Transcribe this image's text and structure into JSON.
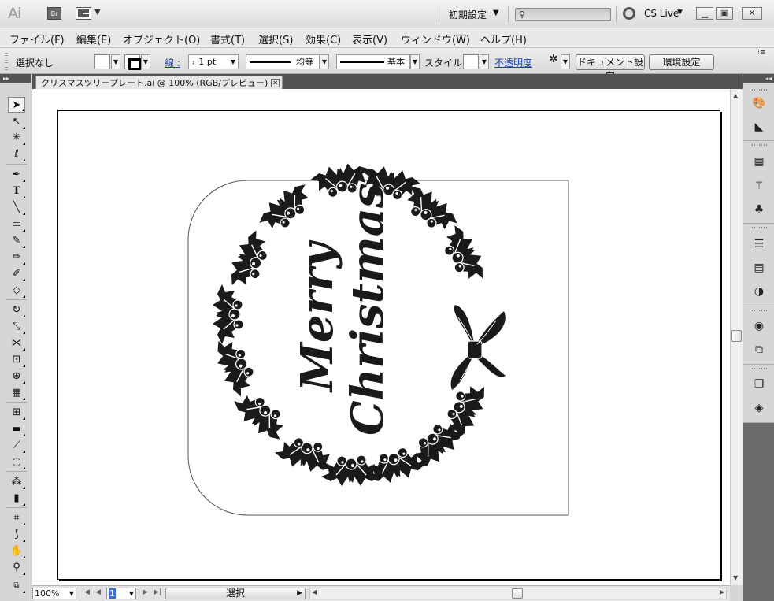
{
  "app": {
    "logo": "Ai",
    "bridge_label": "Br",
    "workspace": "初期設定",
    "search_placeholder": "",
    "cs_live": "CS Live"
  },
  "menu": [
    "ファイル(F)",
    "編集(E)",
    "オブジェクト(O)",
    "書式(T)",
    "選択(S)",
    "効果(C)",
    "表示(V)",
    "ウィンドウ(W)",
    "ヘルプ(H)"
  ],
  "control": {
    "selection_state": "選択なし",
    "stroke_label": "線 :",
    "stroke_weight": "1 pt",
    "profile_label": "均等",
    "brush_label": "基本",
    "style_label": "スタイル :",
    "opacity_label": "不透明度",
    "doc_settings": "ドキュメント設定",
    "prefs": "環境設定"
  },
  "document": {
    "tab_title": "クリスマスツリープレート.ai @ 100% (RGB/プレビュー)",
    "artwork_text_line1": "Merry",
    "artwork_text_line2": "Christmas"
  },
  "status": {
    "zoom": "100%",
    "page": "1",
    "current_tool": "選択"
  },
  "colors": {
    "panel_dark": "#535353",
    "ui_gray": "#d6d6d6",
    "artwork": "#1a1a1a"
  }
}
